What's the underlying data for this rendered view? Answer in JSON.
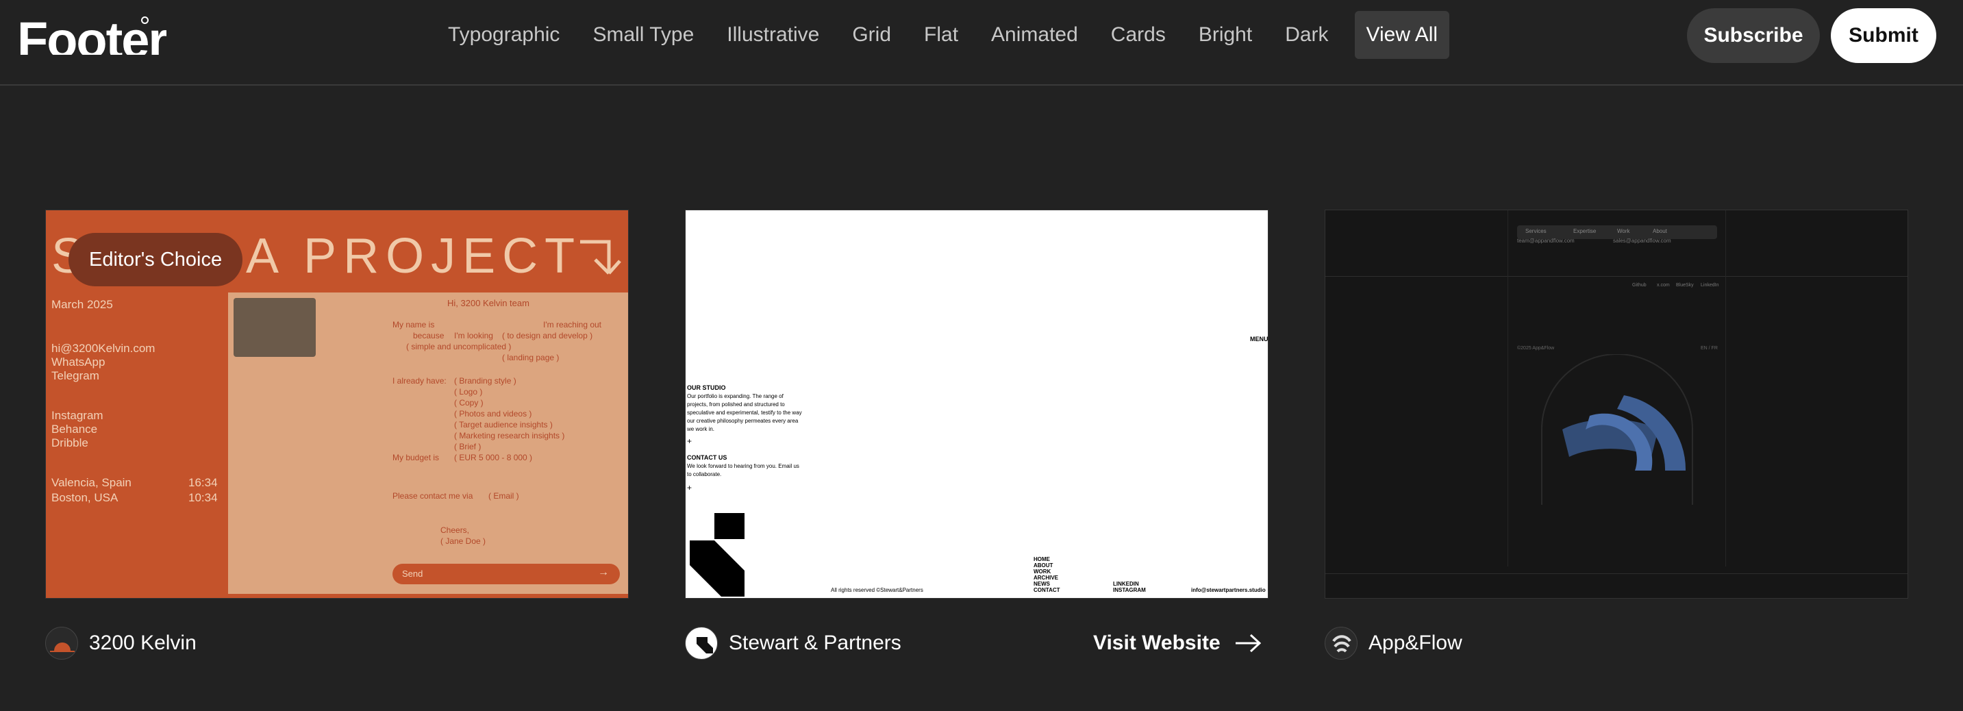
{
  "header": {
    "logo": "Footer",
    "nav": [
      "Typographic",
      "Small Type",
      "Illustrative",
      "Grid",
      "Flat",
      "Animated",
      "Cards",
      "Bright",
      "Dark",
      "View All"
    ],
    "subscribe_label": "Subscribe",
    "submit_label": "Submit"
  },
  "cards": [
    {
      "badge": "Editor's Choice",
      "name": "3200 Kelvin",
      "avatar_icon": "sun-horizon-icon",
      "preview": {
        "headline": "A PROJECT",
        "date_label": "March 2025",
        "email": "hi@3200Kelvin.com",
        "contacts": [
          "WhatsApp",
          "Telegram"
        ],
        "socials": [
          "Instagram",
          "Behance",
          "Dribble"
        ],
        "locations": [
          {
            "city": "Valencia, Spain",
            "time": "16:34"
          },
          {
            "city": "Boston, USA",
            "time": "10:34"
          }
        ],
        "greeting": "Hi, 3200 Kelvin team",
        "form_items": [
          "My name is",
          "I'm reaching out",
          "because",
          "I'm looking",
          "( to design and develop )",
          "( simple and uncomplicated )",
          "( landing page )",
          "I already have:",
          "( Branding style )",
          "( Logo )",
          "( Copy )",
          "( Photos and videos )",
          "( Target audience insights )",
          "( Marketing research insights )",
          "( Brief )",
          "My budget is",
          "( EUR 5 000 - 8 000 )",
          "Please contact me via",
          "( Email )",
          "Cheers,",
          "( Jane Doe )"
        ],
        "send_label": "Send"
      }
    },
    {
      "name": "Stewart & Partners",
      "avatar_icon": "stewart-logo-icon",
      "visit_label": "Visit Website",
      "preview": {
        "menu": "MENU",
        "studio_title": "OUR STUDIO",
        "studio_text": "Our portfolio is expanding. The range of projects, from polished and structured to speculative and experimental, testify to the way our creative philosophy permeates every area we work in.",
        "contact_title": "CONTACT US",
        "contact_text": "We look forward to hearing from you. Email us to collaborate.",
        "rights": "All rights reserved ©Stewart&Partners",
        "links": [
          "HOME",
          "ABOUT",
          "WORK",
          "ARCHIVE",
          "NEWS",
          "CONTACT"
        ],
        "social_links": [
          "LINKEDIN",
          "INSTAGRAM"
        ],
        "email": "info@stewartpartners.studio"
      }
    },
    {
      "name": "App&Flow",
      "avatar_icon": "appflow-logo-icon",
      "preview": {
        "nav": [
          "Services",
          "Expertise",
          "Work",
          "About"
        ],
        "emails": [
          "team@appandflow.com",
          "sales@appandflow.com"
        ],
        "socials": [
          "Github",
          "x.com",
          "BlueSky",
          "LinkedIn"
        ],
        "copyright": "©2025 App&Flow",
        "lang": "EN / FR"
      }
    }
  ],
  "colors": {
    "background": "#222222",
    "card1": "#c4532b",
    "card1_panel": "#dca57f",
    "button_dark": "#3b3b3b"
  }
}
